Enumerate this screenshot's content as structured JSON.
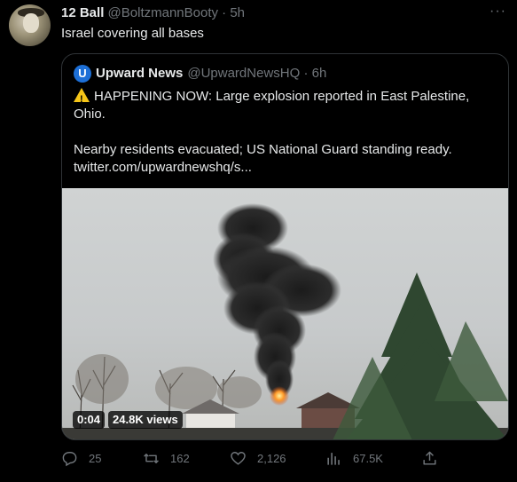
{
  "tweet": {
    "display_name": "12 Ball",
    "handle": "@BoltzmannBooty",
    "separator": "·",
    "time": "5h",
    "more_icon": "ellipsis-icon",
    "text": "Israel covering all bases"
  },
  "quote": {
    "logo_letter": "U",
    "display_name": "Upward News",
    "handle": "@UpwardNewsHQ",
    "separator": "·",
    "time": "6h",
    "line1": "HAPPENING NOW: Large explosion reported in East Palestine, Ohio.",
    "line2": "Nearby residents evacuated; US National Guard standing ready.",
    "link": "twitter.com/upwardnewshq/s...",
    "video_time": "0:04",
    "video_views": "24.8K views"
  },
  "actions": {
    "reply_count": "25",
    "retweet_count": "162",
    "like_count": "2,126",
    "views_count": "67.5K"
  },
  "colors": {
    "background": "#000000",
    "text": "#e7e9ea",
    "muted": "#71767b",
    "border": "#2f3336",
    "accent": "#1d9bf0"
  }
}
